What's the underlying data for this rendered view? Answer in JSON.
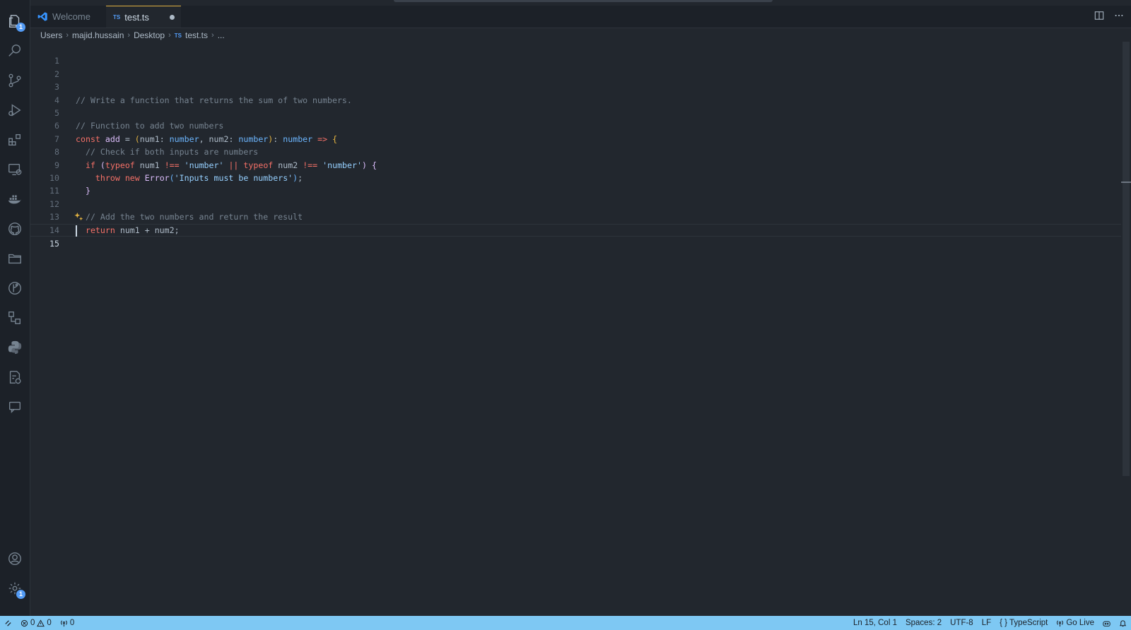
{
  "activity_bar": {
    "explorer_badge": "1",
    "settings_badge": "1"
  },
  "tabs": [
    {
      "label": "Welcome"
    },
    {
      "label": "test.ts",
      "lang_badge": "TS"
    }
  ],
  "breadcrumb": {
    "items": [
      "Users",
      "majid.hussain",
      "Desktop",
      "test.ts",
      "..."
    ],
    "file_badge": "TS"
  },
  "editor": {
    "line_numbers": [
      "1",
      "2",
      "3",
      "4",
      "5",
      "6",
      "7",
      "8",
      "9",
      "10",
      "11",
      "12",
      "13",
      "14",
      "15"
    ],
    "current_line": "15",
    "lines": {
      "l3": "// Write a function that returns the sum of two numbers.",
      "l5": "// Function to add two numbers",
      "l7": "  // Check if both inputs are numbers",
      "l12": "  // Add the two numbers and return the result"
    }
  },
  "statusbar": {
    "errors": "0",
    "warnings": "0",
    "ports": "0",
    "position": "Ln 15, Col 1",
    "spaces": "Spaces: 2",
    "encoding": "UTF-8",
    "eol": "LF",
    "language": "TypeScript",
    "golive": "Go Live"
  },
  "colors": {
    "statusbar_bg": "#7ec8f3",
    "editor_bg": "#22272e",
    "active_tab_accent": "#e3b341"
  }
}
